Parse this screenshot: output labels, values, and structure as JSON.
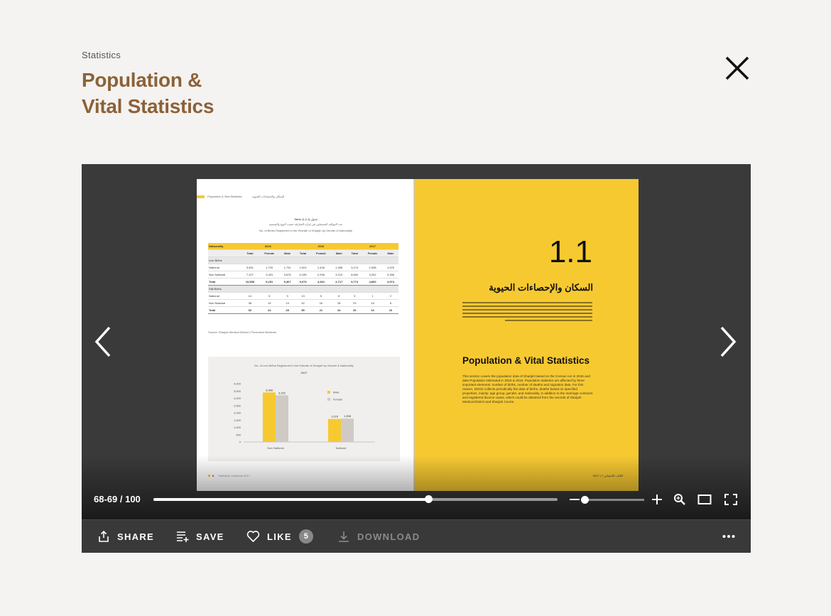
{
  "header": {
    "category": "Statistics",
    "title_line1": "Population &",
    "title_line2": "Vital Statistics"
  },
  "viewer": {
    "page_counter": "68-69 / 100",
    "progress": 0.68,
    "zoom_level": 0.0,
    "left_page": {
      "running_head": "Population & Vital Statistics",
      "running_head_ar": "السكان والإحصاءات الحيوية",
      "table_title": "Table (1.1.1) جدول",
      "table_title_ar": "عدد المواليد المسجلين في إمارة الشارقة حسب النوع والجنسية",
      "table_caption": "No. of Births Registered in the Emirate of Sharjah by Gender & Nationality",
      "table": {
        "years": [
          "2015",
          "2016",
          "2017"
        ],
        "rows": [
          {
            "label": "National",
            "values": [
              "3,451",
              "1,720",
              "1,731",
              "2,924",
              "1,426",
              "1,498",
              "3,174",
              "1,598",
              "1,576"
            ]
          },
          {
            "label": "Non National",
            "values": [
              "7,107",
              "3,431",
              "3,676",
              "6,155",
              "2,936",
              "3,219",
              "6,600",
              "3,202",
              "3,398"
            ]
          },
          {
            "label": "Total",
            "values": [
              "10,558",
              "5,151",
              "5,407",
              "9,079",
              "4,362",
              "4,717",
              "9,774",
              "4,800",
              "4,974"
            ]
          },
          {
            "label": "National",
            "values": [
              "14",
              "5",
              "9",
              "13",
              "5",
              "8",
              "3",
              "1",
              "2"
            ]
          },
          {
            "label": "Non National",
            "values": [
              "38",
              "19",
              "19",
              "42",
              "16",
              "26",
              "23",
              "15",
              "8"
            ]
          },
          {
            "label": "Total",
            "values": [
              "52",
              "24",
              "28",
              "55",
              "21",
              "34",
              "26",
              "16",
              "10"
            ]
          }
        ],
        "sections": [
          "Live Births",
          "Still Births"
        ]
      },
      "source": "Source: Sharjah Medical District | Preventive Medicine",
      "footer": "Statistical Yearbook 2017",
      "page_number": "6"
    },
    "right_page": {
      "section_number": "1.1",
      "title_ar": "السكان والإحصاءات الحيوية",
      "title_en": "Population & Vital Statistics",
      "body_en": "This section covers the population data of Sharjah based on the Census run in 2015 and data Population estimated in 2015 & 2016. Population statistics are affected by three important elements: number of births, number of deaths and migration data. For this reason, DSCD collects periodically the data of births, deaths based on specified properties, mainly: age group, gender, and nationality, in addition to the marriage contracts and registered divorce cases, which could be obtained from the records of Sharjah Medical District and Sharjah Courts.",
      "footer": "2017 | الكتاب الإحصائي",
      "page_number": "7"
    }
  },
  "chart_data": {
    "type": "bar",
    "title": "No. of Live Births Registered in the Emirate of Sharjah by Gender & Nationality",
    "subtitle": "2017",
    "categories": [
      "Non National",
      "National"
    ],
    "series": [
      {
        "name": "Male",
        "values": [
          3398,
          1576
        ],
        "color": "#f7c931"
      },
      {
        "name": "Female",
        "values": [
          3202,
          1598
        ],
        "color": "#cfcbc4"
      }
    ],
    "ylim": [
      0,
      4000
    ],
    "yticks": [
      "4,000",
      "3,500",
      "3,000",
      "2,500",
      "2,000",
      "1,500",
      "1,000",
      "500",
      "0"
    ],
    "data_labels": [
      "3,398",
      "3,202",
      "1,576",
      "1,598"
    ]
  },
  "controls": {
    "prev_icon": "chevron-left-icon",
    "next_icon": "chevron-right-icon"
  },
  "toolbar": {
    "share_label": "SHARE",
    "save_label": "SAVE",
    "like_label": "LIKE",
    "like_count": "5",
    "download_label": "DOWNLOAD"
  }
}
